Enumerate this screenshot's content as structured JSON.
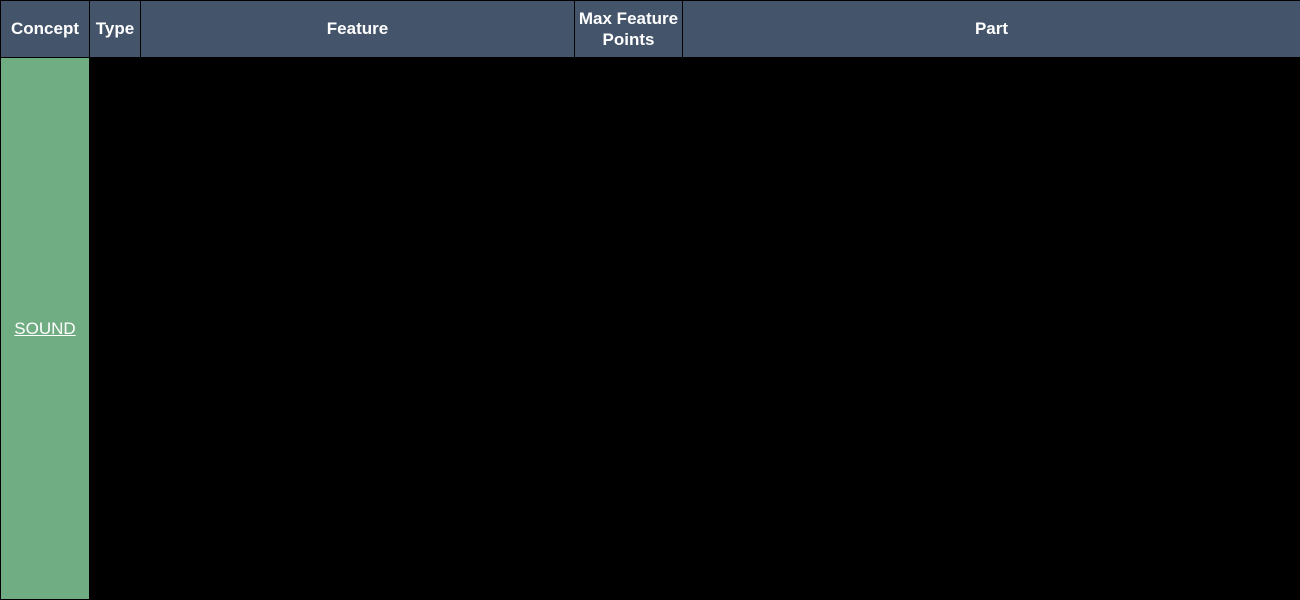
{
  "table": {
    "headers": {
      "concept": "Concept",
      "type": "Type",
      "feature": "Feature",
      "max_feature_points": "Max Feature Points",
      "part": "Part"
    },
    "row": {
      "concept_label": "SOUND"
    }
  }
}
